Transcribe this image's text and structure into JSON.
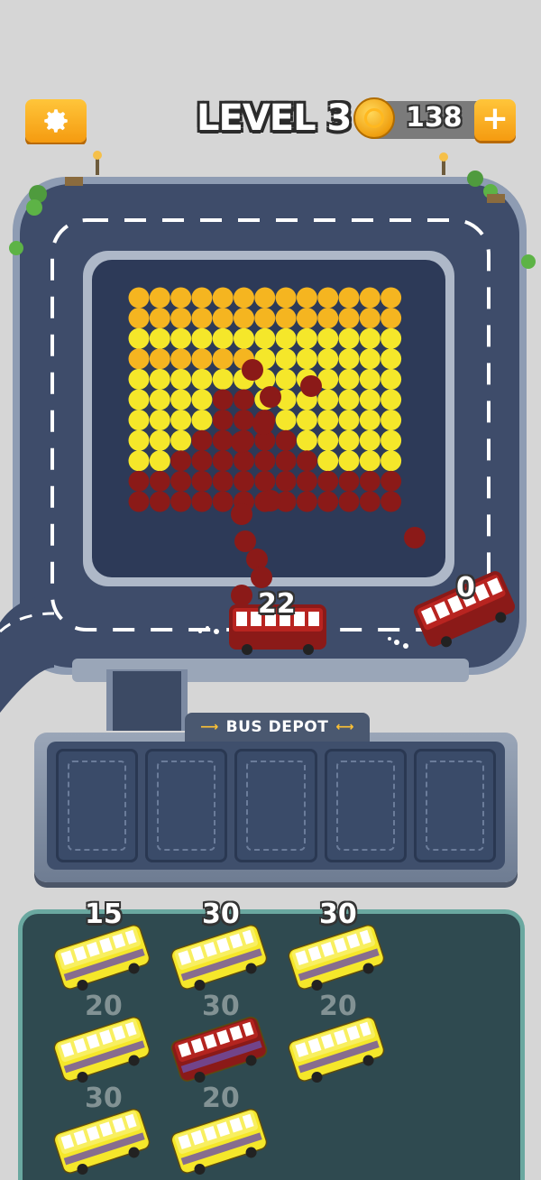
{
  "hud": {
    "level_label": "LEVEL 3",
    "coins": "138",
    "plus_label": "+"
  },
  "board": {
    "bus_on_road_count": "22",
    "bus_loading_count": "0"
  },
  "depot": {
    "title": "BUS DEPOT",
    "slots": [
      "",
      "",
      "",
      "",
      ""
    ]
  },
  "garage": {
    "buses": [
      {
        "count": "15",
        "color": "yellow",
        "active": true
      },
      {
        "count": "30",
        "color": "yellow",
        "active": true
      },
      {
        "count": "30",
        "color": "yellow",
        "active": true
      },
      {
        "count": "20",
        "color": "yellow",
        "active": false
      },
      {
        "count": "30",
        "color": "red",
        "active": false
      },
      {
        "count": "20",
        "color": "yellow",
        "active": false
      },
      {
        "count": "30",
        "color": "yellow",
        "active": false
      },
      {
        "count": "20",
        "color": "yellow",
        "active": false
      }
    ]
  },
  "colors": {
    "yellow": "#f5e72a",
    "orange": "#f5b520",
    "red": "#8b1a18",
    "road": "#3e4c6a"
  }
}
